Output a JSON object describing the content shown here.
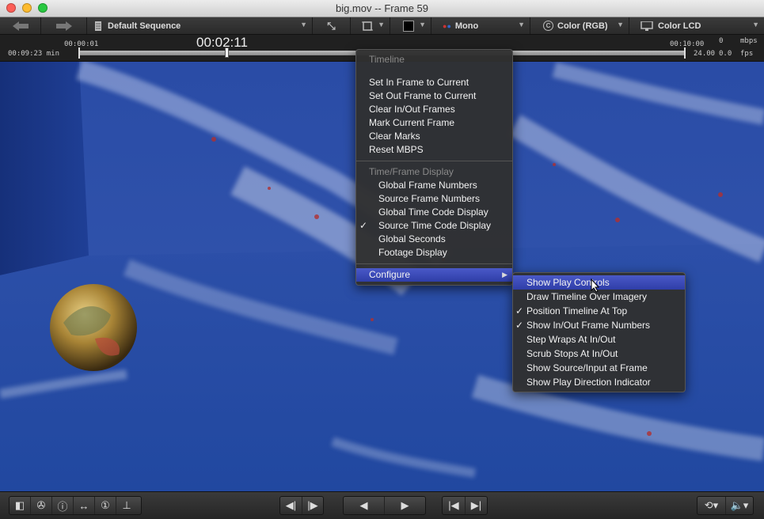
{
  "window": {
    "title": "big.mov -- Frame 59"
  },
  "toolbar": {
    "back_icon": "back-arrow-icon",
    "forward_icon": "forward-arrow-icon",
    "sequence": "Default Sequence",
    "stereo": "Mono",
    "color_space": "Color (RGB)",
    "display": "Color LCD"
  },
  "timeline": {
    "in_time": "00:00:01",
    "current_timecode": "00:02:11",
    "duration": "00:09:23 min",
    "out_time": "00:10:00",
    "fps_target": "24.00",
    "fps_actual": "0.0",
    "mbps": "0",
    "mbps_label": "mbps",
    "fps_label": "fps",
    "playhead_fraction": 0.24
  },
  "menu": {
    "header_timeline": "Timeline",
    "set_in": "Set In Frame to Current",
    "set_out": "Set Out Frame to Current",
    "clear_inout": "Clear In/Out Frames",
    "mark_current": "Mark Current Frame",
    "clear_marks": "Clear Marks",
    "reset_mbps": "Reset MBPS",
    "header_display": "Time/Frame Display",
    "global_frames": "Global Frame Numbers",
    "source_frames": "Source Frame Numbers",
    "global_tc": "Global Time Code Display",
    "source_tc": "Source Time Code Display",
    "global_seconds": "Global Seconds",
    "footage": "Footage Display",
    "configure": "Configure",
    "checkmark": "✓"
  },
  "submenu": {
    "show_play_controls": "Show Play Controls",
    "draw_timeline": "Draw Timeline Over Imagery",
    "position_top": "Position Timeline At Top",
    "show_inout_numbers": "Show In/Out Frame Numbers",
    "step_wraps": "Step Wraps At In/Out",
    "scrub_stops": "Scrub Stops At In/Out",
    "show_source": "Show Source/Input at Frame",
    "show_direction": "Show Play Direction Indicator",
    "checkmark": "✓"
  },
  "colors": {
    "menu_highlight": "#3a49b8",
    "viewport_blue": "#1f3a8a"
  }
}
